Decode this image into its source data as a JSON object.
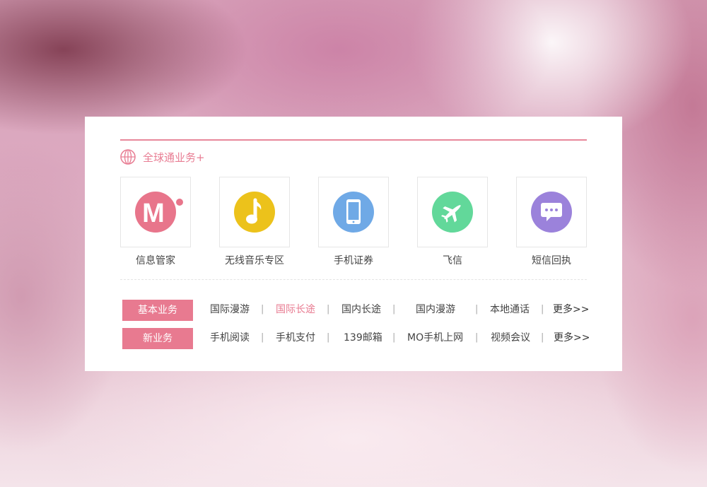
{
  "header": {
    "title": "全球通业务+",
    "title_icon": "globe-icon"
  },
  "features": [
    {
      "label": "信息管家",
      "icon": "m-logo-icon",
      "color": "#e8758b"
    },
    {
      "label": "无线音乐专区",
      "icon": "music-note-icon",
      "color": "#ecc21b"
    },
    {
      "label": "手机证券",
      "icon": "phone-icon",
      "color": "#6fa9e6"
    },
    {
      "label": "飞信",
      "icon": "airplane-icon",
      "color": "#62d89a"
    },
    {
      "label": "短信回执",
      "icon": "chat-bubble-icon",
      "color": "#9b82db"
    }
  ],
  "services": [
    {
      "tag": "基本业务",
      "links": [
        "国际漫游",
        "国际长途",
        "国内长途",
        "国内漫游",
        "本地通话"
      ],
      "active_index": 1,
      "more": "更多>>"
    },
    {
      "tag": "新业务",
      "links": [
        "手机阅读",
        "手机支付",
        "139邮箱",
        "MO手机上网",
        "视频会议"
      ],
      "active_index": -1,
      "more": "更多>>"
    }
  ],
  "colors": {
    "accent": "#e87a90",
    "text": "#444444",
    "border": "#e6e6e6"
  }
}
